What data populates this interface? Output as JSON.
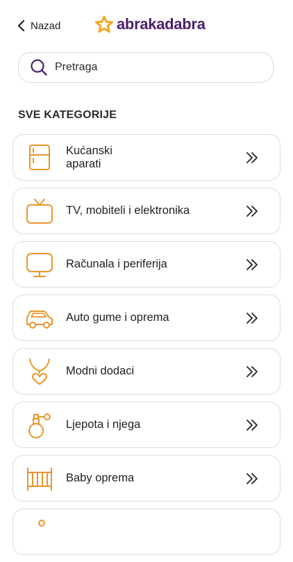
{
  "header": {
    "back_label": "Nazad",
    "logo_text": "abrakadabra",
    "logo_color": "#4b1e6b",
    "logo_star_color": "#f5a623"
  },
  "search": {
    "placeholder": "Pretraga",
    "value": ""
  },
  "section_title": "SVE KATEGORIJE",
  "accent_color": "#e8952a",
  "categories": [
    {
      "label": "Kućanski\naparati",
      "icon": "fridge-icon"
    },
    {
      "label": "TV, mobiteli i elektronika",
      "icon": "tv-icon"
    },
    {
      "label": "Računala i periferija",
      "icon": "monitor-icon"
    },
    {
      "label": "Auto gume i oprema",
      "icon": "car-icon"
    },
    {
      "label": "Modni dodaci",
      "icon": "necklace-icon"
    },
    {
      "label": "Ljepota i njega",
      "icon": "perfume-icon"
    },
    {
      "label": "Baby oprema",
      "icon": "crib-icon"
    }
  ]
}
